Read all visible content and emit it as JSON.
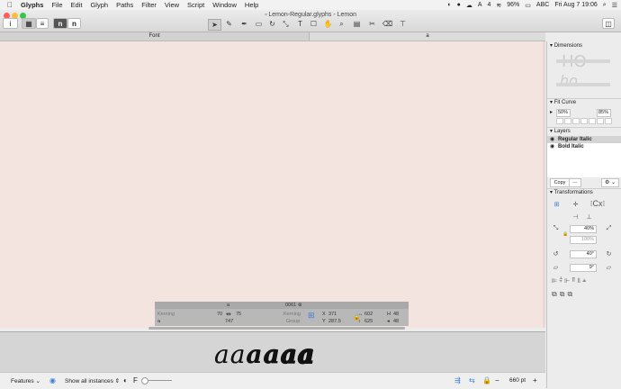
{
  "menubar": {
    "apple": "",
    "app": "Glyphs",
    "items": [
      "File",
      "Edit",
      "Glyph",
      "Paths",
      "Filter",
      "View",
      "Script",
      "Window",
      "Help"
    ],
    "status": {
      "battery": "96%",
      "keyboard": "ABC",
      "datetime": "Fri Aug 7  19:06",
      "count": "4"
    }
  },
  "window": {
    "title": "Lemon-Regular.glyphs - Lemon"
  },
  "tabs": {
    "left": "Font",
    "right": "a"
  },
  "infobox": {
    "glyph": "a",
    "unicode": "0061",
    "kerning_left_label": "Kerning",
    "kerning_right_label": "Kerning",
    "group_label": "Group",
    "glyph_name": "a",
    "lsb": "70",
    "rsb": "75",
    "width": "747",
    "x": "371",
    "y": "287.5",
    "w": "602",
    "h": "625",
    "field_h": "48",
    "field_w": "48"
  },
  "preview": {
    "text": "aaaaaa"
  },
  "bottombar": {
    "features": "Features",
    "instances": "Show all instances",
    "zoom": "660 pt"
  },
  "panel": {
    "dimensions": {
      "title": "Dimensions"
    },
    "fitcurve": {
      "title": "Fit Curve",
      "min": "50%",
      "max": "85%"
    },
    "layers": {
      "title": "Layers",
      "items": [
        "Regular Italic",
        "Bold Italic"
      ],
      "copy_label": "Copy"
    },
    "transformations": {
      "title": "Transformations",
      "scale": "40%",
      "scale2": "100%",
      "rotate": "40°",
      "slant": "9°"
    }
  },
  "colors": {
    "canvas": "#f4e4df",
    "accent": "#3b7fd6"
  }
}
